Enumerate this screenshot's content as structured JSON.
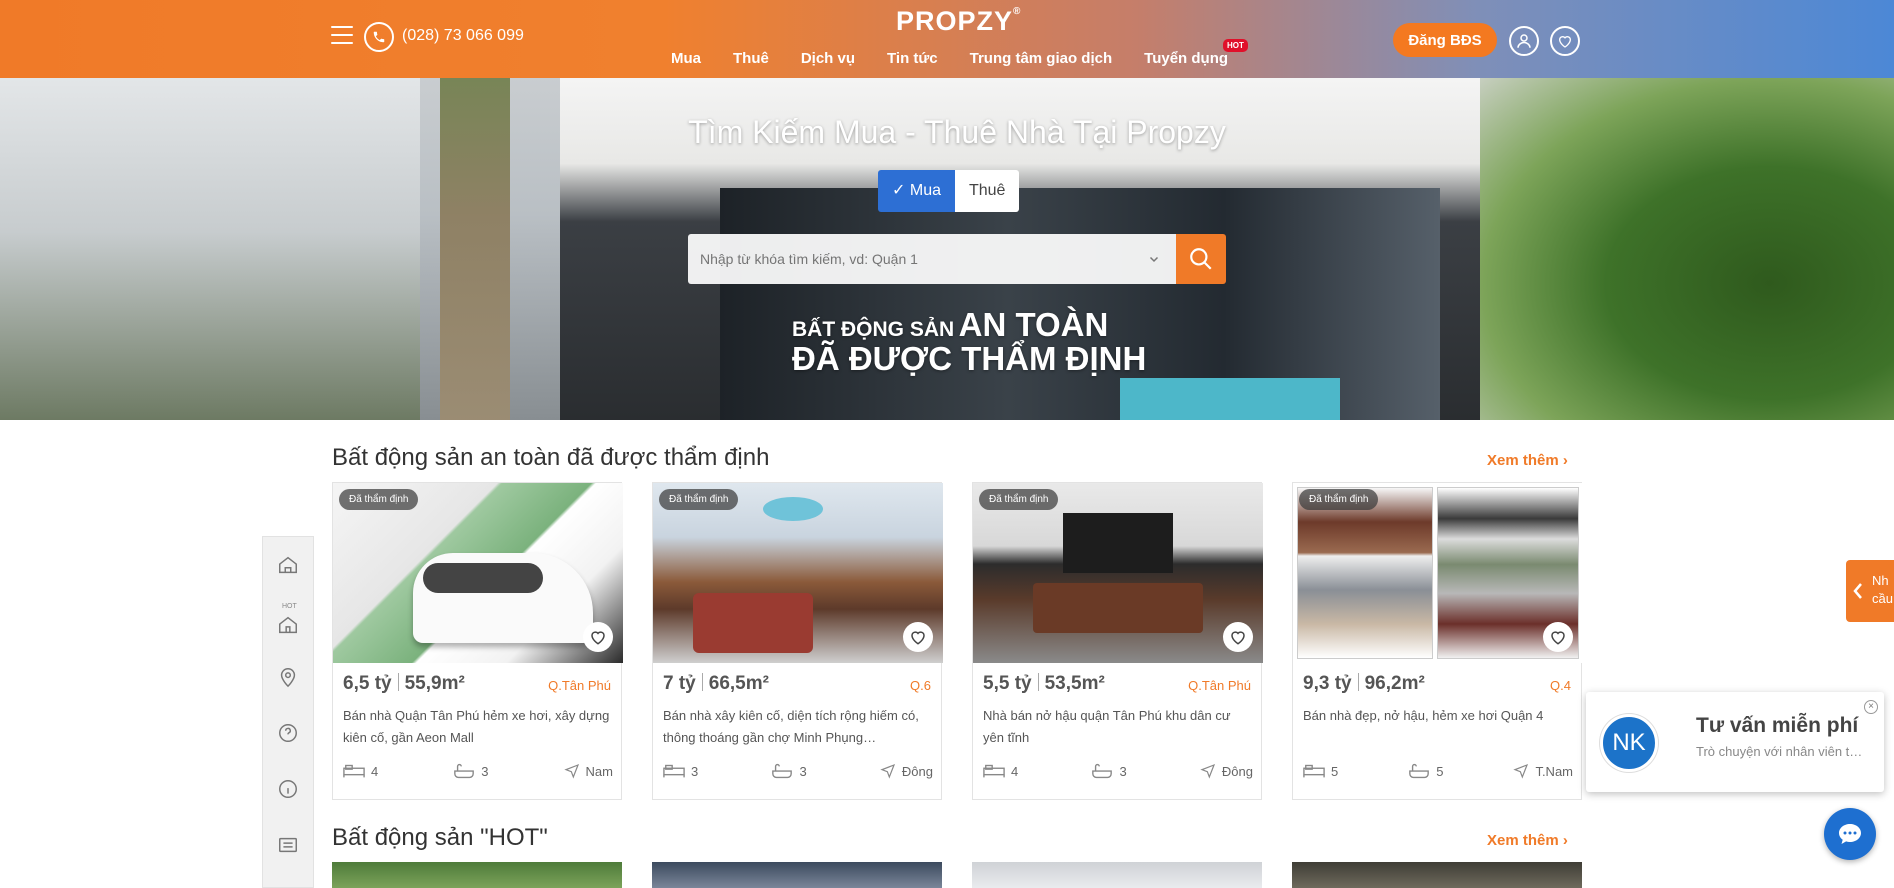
{
  "header": {
    "phone": "(028) 73 066 099",
    "logo": "PROPZY",
    "logo_mark": "®",
    "nav": [
      "Mua",
      "Thuê",
      "Dịch vụ",
      "Tin tức",
      "Trung tâm giao dịch",
      "Tuyển dụng"
    ],
    "hot_badge": "HOT",
    "post_button": "Đăng BĐS"
  },
  "hero": {
    "title": "Tìm Kiếm Mua - Thuê Nhà Tại Propzy",
    "toggle": {
      "buy": "Mua",
      "rent": "Thuê",
      "check": "✓"
    },
    "search_placeholder": "Nhập từ khóa tìm kiếm, vd: Quận 1",
    "slogan_small": "BẤT ĐỘNG SẢN",
    "slogan_big": "AN TOÀN",
    "slogan_line2": "ĐÃ ĐƯỢC THẨM ĐỊNH"
  },
  "section1": {
    "title": "Bất động sản an toàn đã được thẩm định",
    "see_more": "Xem thêm",
    "cards": [
      {
        "badge": "Đã thẩm định",
        "price": "6,5 tỷ",
        "area": "55,9m²",
        "district": "Q.Tân Phú",
        "desc": "Bán nhà Quận Tân Phú hẻm xe hơi, xây dựng kiên cố, gần Aeon Mall",
        "beds": "4",
        "baths": "3",
        "dir": "Nam"
      },
      {
        "badge": "Đã thẩm định",
        "price": "7 tỷ",
        "area": "66,5m²",
        "district": "Q.6",
        "desc": "Bán nhà xây kiên cố, diện tích rộng hiếm có, thông thoáng gần chợ Minh Phụng…",
        "beds": "3",
        "baths": "3",
        "dir": "Đông"
      },
      {
        "badge": "Đã thẩm định",
        "price": "5,5 tỷ",
        "area": "53,5m²",
        "district": "Q.Tân Phú",
        "desc": "Nhà bán nở hậu quận Tân Phú khu dân cư yên tĩnh",
        "beds": "4",
        "baths": "3",
        "dir": "Đông"
      },
      {
        "badge": "Đã thẩm định",
        "price": "9,3 tỷ",
        "area": "96,2m²",
        "district": "Q.4",
        "desc": "Bán nhà đẹp, nở hậu, hẻm xe hơi Quận 4",
        "beds": "5",
        "baths": "5",
        "dir": "T.Nam"
      }
    ]
  },
  "section2": {
    "title": "Bất động sản \"HOT\"",
    "see_more": "Xem thêm"
  },
  "rail": {
    "hot_label": "HOT"
  },
  "widgets": {
    "edge_tab": "Nh\ncầu",
    "chat_avatar": "NK",
    "chat_title": "Tư vấn miễn phí",
    "chat_sub": "Trò chuyện với nhân viên tư vấn",
    "chat_close": "×"
  },
  "colors": {
    "accent": "#f07a28",
    "blue": "#2d6fd4",
    "chat_blue": "#1e6fd0"
  }
}
